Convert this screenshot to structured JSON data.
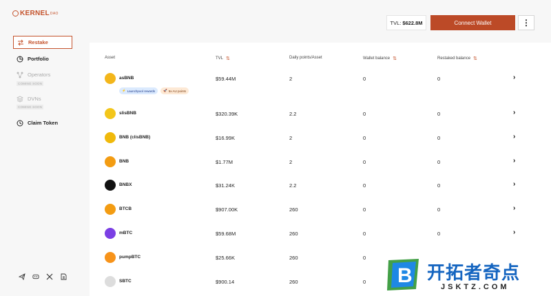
{
  "logo": {
    "text": "KERNEL",
    "sup": "DAO"
  },
  "sidebar": {
    "items": [
      {
        "label": "Restake",
        "icon": "arrows-swap-icon"
      },
      {
        "label": "Portfolio",
        "icon": "pie-chart-icon"
      },
      {
        "label": "Operators",
        "icon": "network-icon",
        "badge": "COMING SOON"
      },
      {
        "label": "DVNs",
        "icon": "layers-icon",
        "badge": "COMING SOON"
      },
      {
        "label": "Claim Token",
        "icon": "clock-icon"
      }
    ],
    "social": [
      "telegram-icon",
      "discord-icon",
      "x-icon",
      "docs-icon"
    ]
  },
  "header": {
    "tvl_label": "TVL:",
    "tvl_value": "$622.8M",
    "connect_label": "Connect Wallet",
    "more_label": "⋮"
  },
  "table": {
    "columns": [
      "Asset",
      "TVL",
      "Daily points/Asset",
      "Wallet balance",
      "Restaked balance"
    ],
    "badges": [
      "Launchpool rewards",
      "5x AU points"
    ],
    "rows": [
      {
        "name": "asBNB",
        "tvl": "$59.44M",
        "points": "2",
        "wallet": "0",
        "restaked": "0",
        "color": "#f3b61b"
      },
      {
        "name": "slisBNB",
        "tvl": "$320.39K",
        "points": "2.2",
        "wallet": "0",
        "restaked": "0",
        "color": "#f3c61b"
      },
      {
        "name": "BNB (clisBNB)",
        "tvl": "$16.99K",
        "points": "2",
        "wallet": "0",
        "restaked": "0",
        "color": "#f0b90b"
      },
      {
        "name": "BNB",
        "tvl": "$1.77M",
        "points": "2",
        "wallet": "0",
        "restaked": "0",
        "color": "#f39c12"
      },
      {
        "name": "BNBX",
        "tvl": "$31.24K",
        "points": "2.2",
        "wallet": "0",
        "restaked": "0",
        "color": "#111111"
      },
      {
        "name": "BTCB",
        "tvl": "$907.00K",
        "points": "260",
        "wallet": "0",
        "restaked": "0",
        "color": "#f39c12"
      },
      {
        "name": "mBTC",
        "tvl": "$59.68M",
        "points": "260",
        "wallet": "0",
        "restaked": "0",
        "color": "#7b3fe4"
      },
      {
        "name": "pumpBTC",
        "tvl": "$25.66K",
        "points": "260",
        "wallet": "0",
        "restaked": "0",
        "color": "#f7931a"
      },
      {
        "name": "SBTC",
        "tvl": "$900.14",
        "points": "260",
        "wallet": "0",
        "restaked": "0",
        "color": "#dddddd"
      }
    ]
  },
  "watermark": {
    "title": "开拓者奇点",
    "url": "JSKTZ.COM",
    "letter": "B"
  }
}
